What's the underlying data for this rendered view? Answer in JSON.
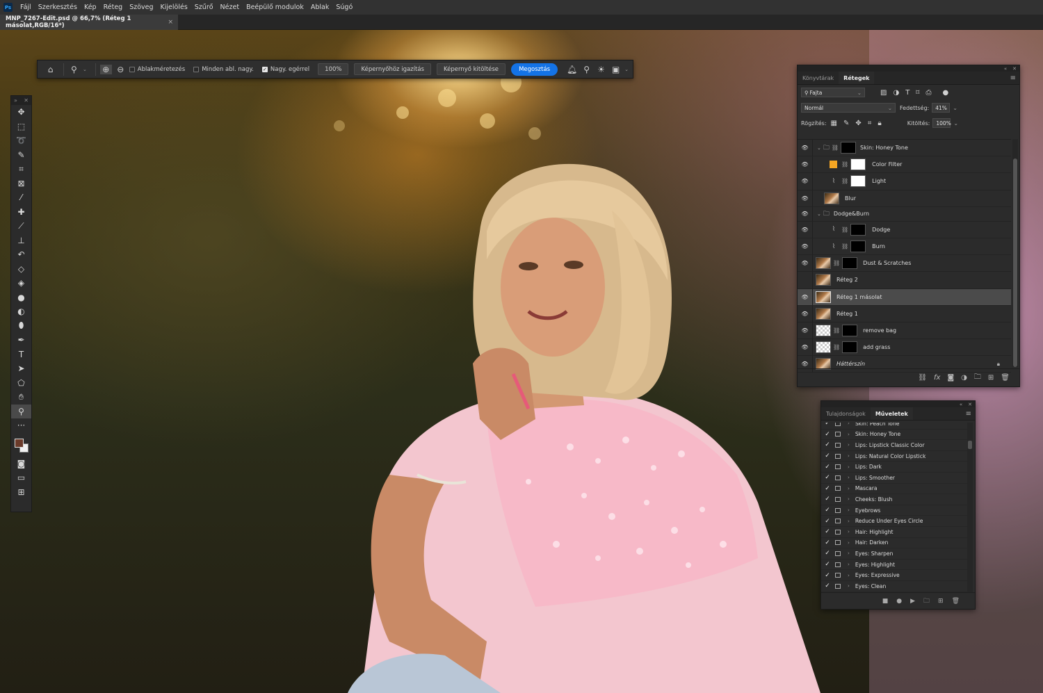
{
  "app": {
    "logo": "Ps"
  },
  "menu": [
    "Fájl",
    "Szerkesztés",
    "Kép",
    "Réteg",
    "Szöveg",
    "Kijelölés",
    "Szűrő",
    "Nézet",
    "Beépülő modulok",
    "Ablak",
    "Súgó"
  ],
  "document": {
    "tab_title": "MNP_7267-Edit.psd @ 66,7% (Réteg 1 másolat,RGB/16*)",
    "close": "×"
  },
  "options": {
    "resize_windows": "Ablakméretezés",
    "zoom_all": "Minden abl. nagy.",
    "scrubby_zoom": "Nagy. egérrel",
    "zoom_value": "100%",
    "fit_screen": "Képernyőhöz igazítás",
    "fill_screen": "Képernyő kitöltése",
    "share": "Megosztás"
  },
  "tools": [
    "move-tool",
    "marquee-tool",
    "lasso-tool",
    "quick-selection-tool",
    "crop-tool",
    "frame-tool",
    "eyedropper-tool",
    "healing-brush-tool",
    "brush-tool",
    "clone-stamp-tool",
    "history-brush-tool",
    "eraser-tool",
    "paint-bucket-tool",
    "dodge-tool",
    "blur-tool",
    "smudge-tool",
    "pen-tool",
    "type-tool",
    "path-selection-tool",
    "shape-tool",
    "hand-tool",
    "zoom-tool"
  ],
  "colors": {
    "foreground": "#6a3a2a",
    "background": "#f2f2f2",
    "accent": "#1473e6",
    "color_filter": "#f5a623"
  },
  "layers_panel": {
    "tabs": [
      "Könyvtárak",
      "Rétegek"
    ],
    "filter_label": "Fajta",
    "blend_mode": "Normál",
    "opacity_label": "Fedettség:",
    "opacity_value": "41%",
    "lock_label": "Rögzítés:",
    "fill_label": "Kitöltés:",
    "fill_value": "100%",
    "layers": [
      {
        "name": "Skin: Honey Tone",
        "kind": "group",
        "visible": true,
        "selected": false
      },
      {
        "name": "Color Filter",
        "kind": "solid",
        "visible": true,
        "selected": false
      },
      {
        "name": "Light",
        "kind": "curves",
        "visible": true,
        "selected": false
      },
      {
        "name": "Blur",
        "kind": "photo",
        "visible": true,
        "selected": false
      },
      {
        "name": "Dodge&Burn",
        "kind": "group-plain",
        "visible": true,
        "selected": false
      },
      {
        "name": "Dodge",
        "kind": "curves-black",
        "visible": true,
        "selected": false
      },
      {
        "name": "Burn",
        "kind": "curves-black",
        "visible": true,
        "selected": false
      },
      {
        "name": "Dust & Scratches",
        "kind": "photo-mask",
        "visible": true,
        "selected": false
      },
      {
        "name": "Réteg 2",
        "kind": "photo",
        "visible": false,
        "selected": false
      },
      {
        "name": "Réteg 1 másolat",
        "kind": "photo",
        "visible": true,
        "selected": true
      },
      {
        "name": "Réteg 1",
        "kind": "photo",
        "visible": true,
        "selected": false
      },
      {
        "name": "remove bag",
        "kind": "checker-mask",
        "visible": true,
        "selected": false
      },
      {
        "name": "add grass",
        "kind": "checker-mask",
        "visible": true,
        "selected": false
      },
      {
        "name": "Háttérszín",
        "kind": "background",
        "visible": true,
        "selected": false
      }
    ]
  },
  "actions_panel": {
    "tabs": [
      "Tulajdonságok",
      "Műveletek"
    ],
    "actions": [
      "Skin: Peach Tone",
      "Skin: Honey Tone",
      "Lips: Lipstick Classic Color",
      "Lips: Natural Color Lipstick",
      "Lips: Dark",
      "Lips: Smoother",
      "Mascara",
      "Cheeks: Blush",
      "Eyebrows",
      "Reduce Under Eyes Circle",
      "Hair: Highlight",
      "Hair: Darken",
      "Eyes: Sharpen",
      "Eyes: Highlight",
      "Eyes: Expressive",
      "Eyes: Clean"
    ]
  }
}
